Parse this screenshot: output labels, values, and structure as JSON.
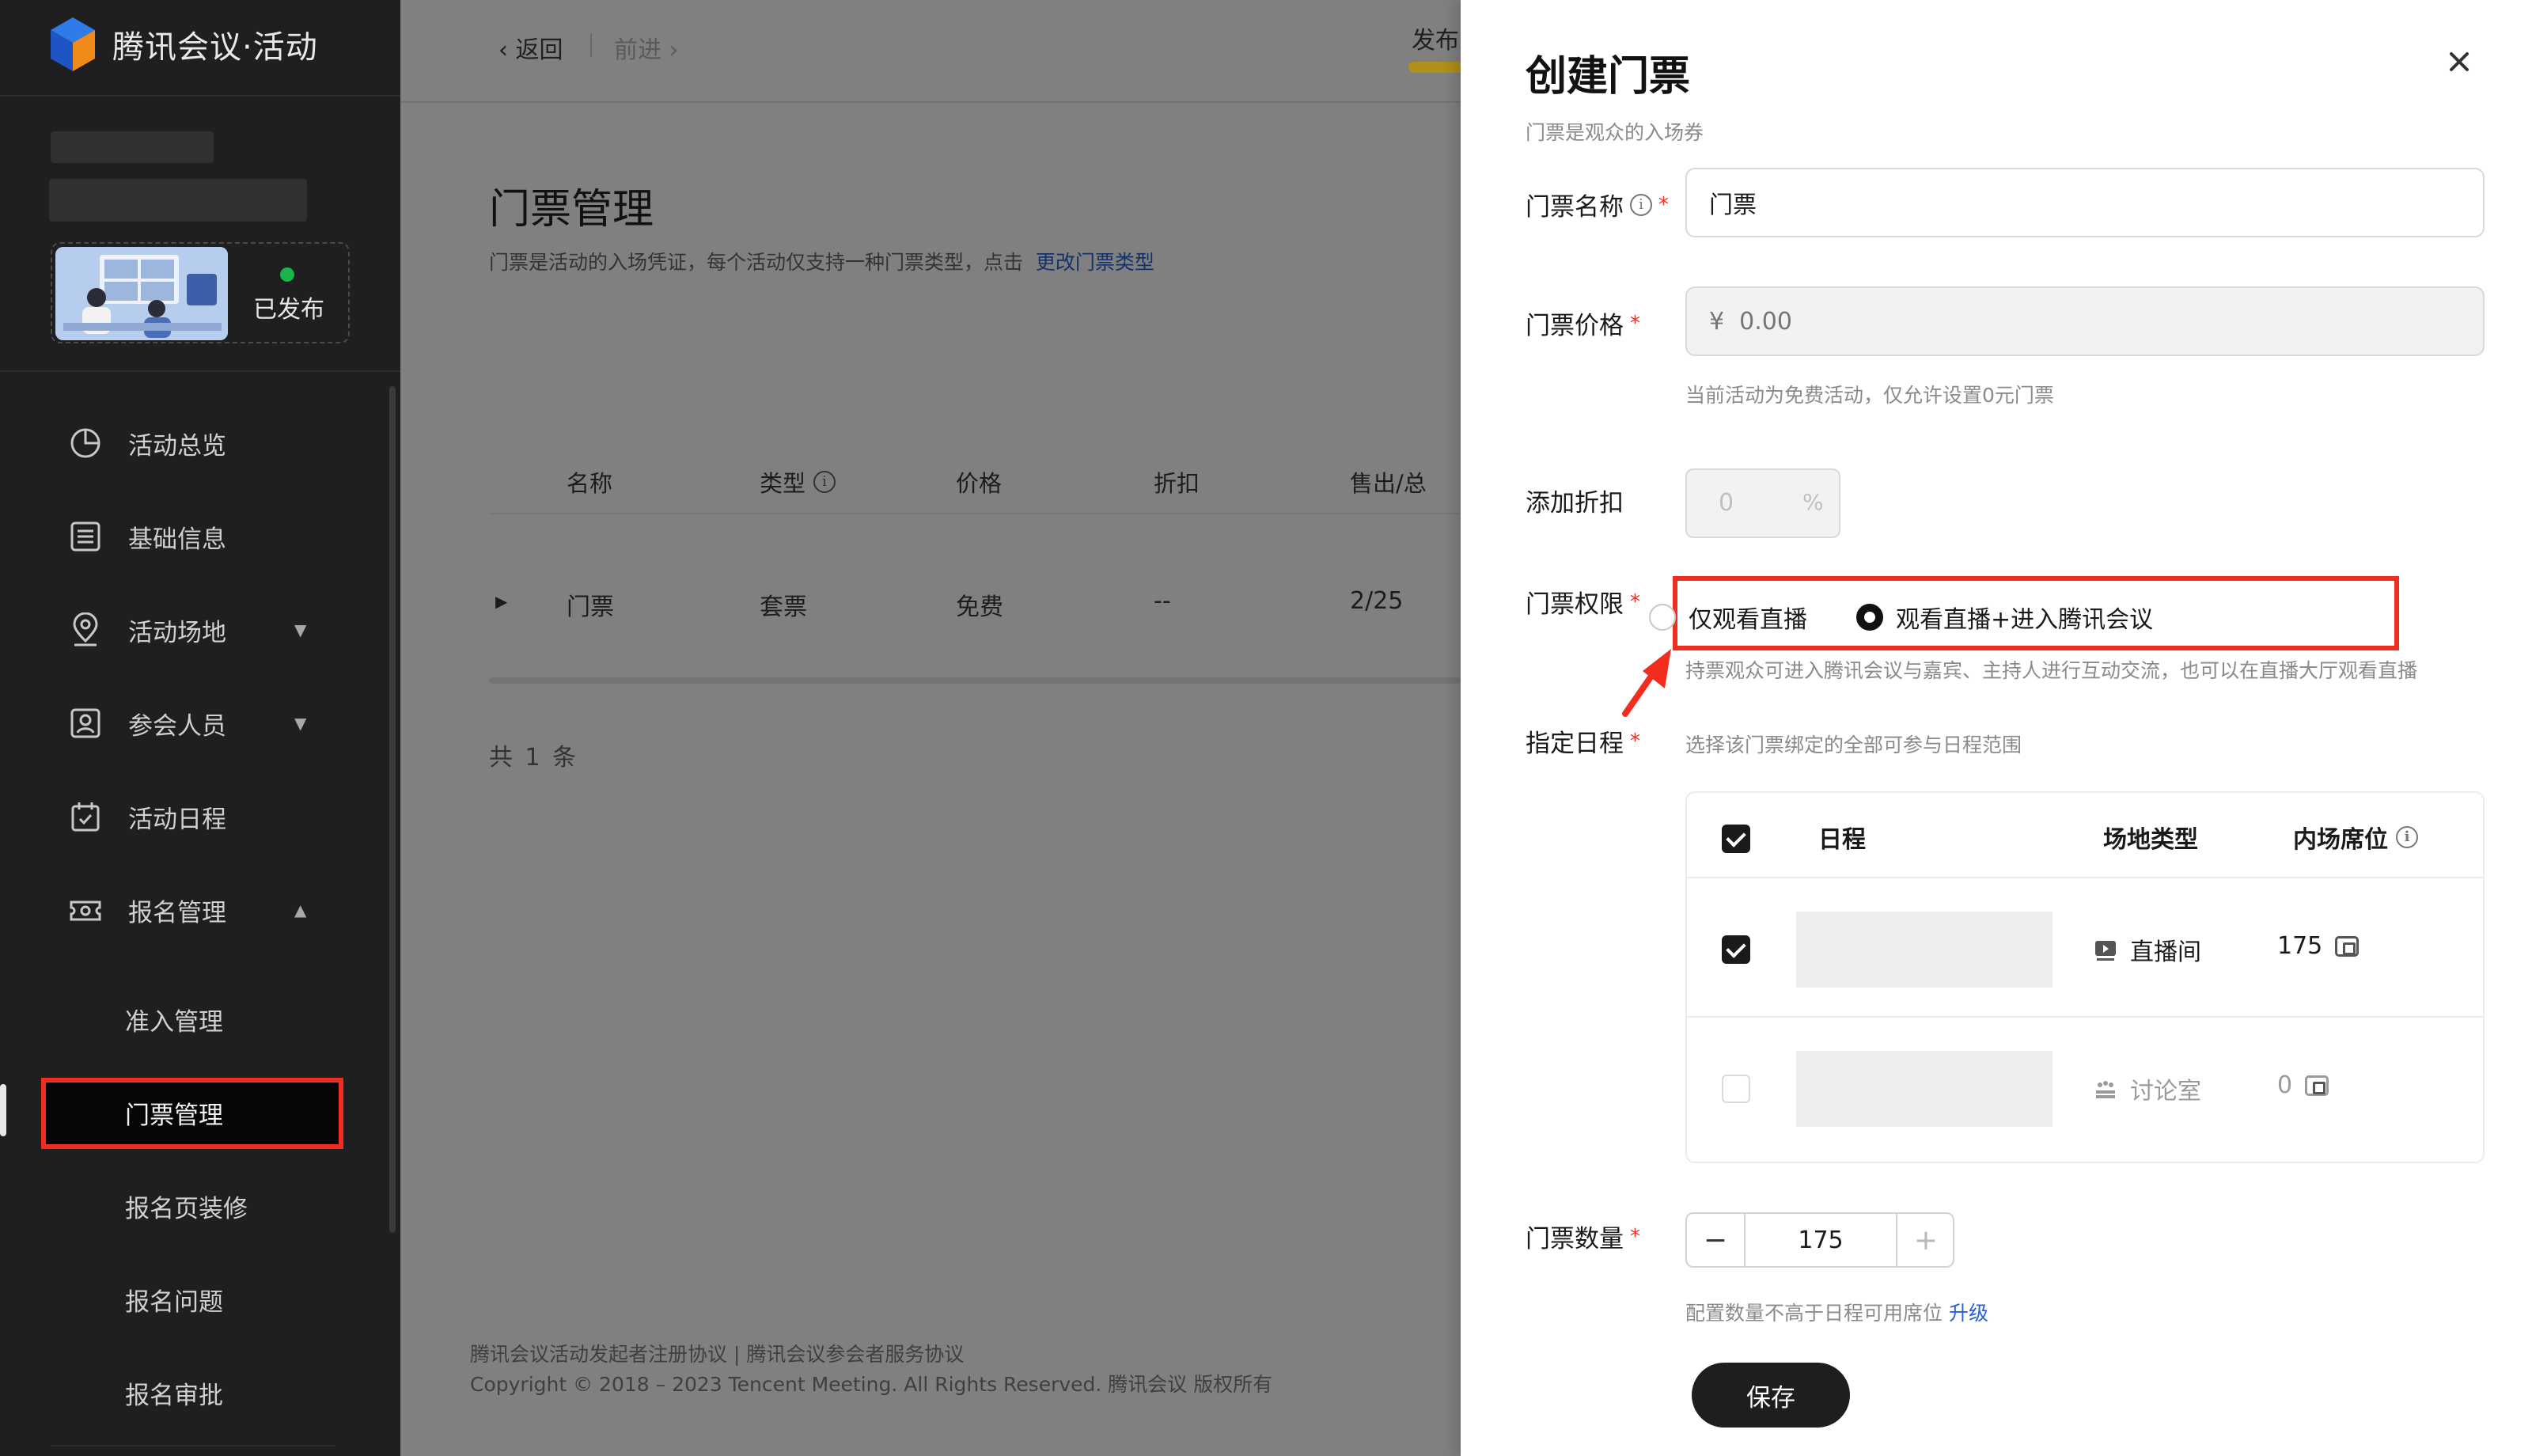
{
  "app": {
    "logo_text": "腾讯会议·活动"
  },
  "event": {
    "status": "已发布"
  },
  "sidebar": {
    "items": [
      {
        "label": "活动总览",
        "icon": "pie-chart-icon"
      },
      {
        "label": "基础信息",
        "icon": "list-icon"
      },
      {
        "label": "活动场地",
        "icon": "location-pin-icon"
      },
      {
        "label": "参会人员",
        "icon": "person-card-icon"
      },
      {
        "label": "活动日程",
        "icon": "calendar-check-icon"
      },
      {
        "label": "报名管理",
        "icon": "ticket-icon"
      }
    ],
    "subitems": [
      "准入管理",
      "门票管理",
      "报名页装修",
      "报名问题",
      "报名审批"
    ],
    "active": "门票管理"
  },
  "nav": {
    "back": "返回",
    "forward": "前进",
    "publish": "发布"
  },
  "page": {
    "title": "门票管理",
    "desc": "门票是活动的入场凭证，每个活动仅支持一种门票类型，点击",
    "desc_link": "更改门票类型",
    "table": {
      "headers": [
        "名称",
        "类型",
        "价格",
        "折扣",
        "售出/总"
      ],
      "row": [
        "门票",
        "套票",
        "免费",
        "--",
        "2/25"
      ]
    },
    "total": "共 1 条",
    "footer_line1": "腾讯会议活动发起者注册协议 | 腾讯会议参会者服务协议",
    "footer_line2": "Copyright © 2018 – 2023 Tencent Meeting. All Rights Reserved. 腾讯会议 版权所有"
  },
  "drawer": {
    "title": "创建门票",
    "subtitle": "门票是观众的入场券",
    "name_label": "门票名称",
    "name_value": "门票",
    "price_label": "门票价格",
    "price_placeholder": "¥  0.00",
    "price_hint": "当前活动为免费活动，仅允许设置0元门票",
    "discount_label": "添加折扣",
    "discount_placeholder": "0",
    "discount_unit": "%",
    "perm_label": "门票权限",
    "perm_options": [
      "仅观看直播",
      "观看直播+进入腾讯会议"
    ],
    "perm_selected": 1,
    "perm_hint": "持票观众可进入腾讯会议与嘉宾、主持人进行互动交流，也可以在直播大厅观看直播",
    "schedule_label": "指定日程",
    "schedule_hint": "选择该门票绑定的全部可参与日程范围",
    "schedule_headers": [
      "日程",
      "场地类型",
      "内场席位"
    ],
    "schedule_rows": [
      {
        "checked": true,
        "venue": "直播间",
        "venue_icon": "live-room-icon",
        "seats": "175"
      },
      {
        "checked": false,
        "venue": "讨论室",
        "venue_icon": "discussion-room-icon",
        "seats": "0"
      }
    ],
    "qty_label": "门票数量",
    "qty_value": "175",
    "qty_hint": "配置数量不高于日程可用席位",
    "qty_hint_link": "升级",
    "save": "保存"
  },
  "colors": {
    "highlight": "#f02d1f",
    "link": "#2b5fd9",
    "status_green": "#19b44a",
    "publish_accent": "#b08f1a",
    "required": "#e6392c"
  }
}
